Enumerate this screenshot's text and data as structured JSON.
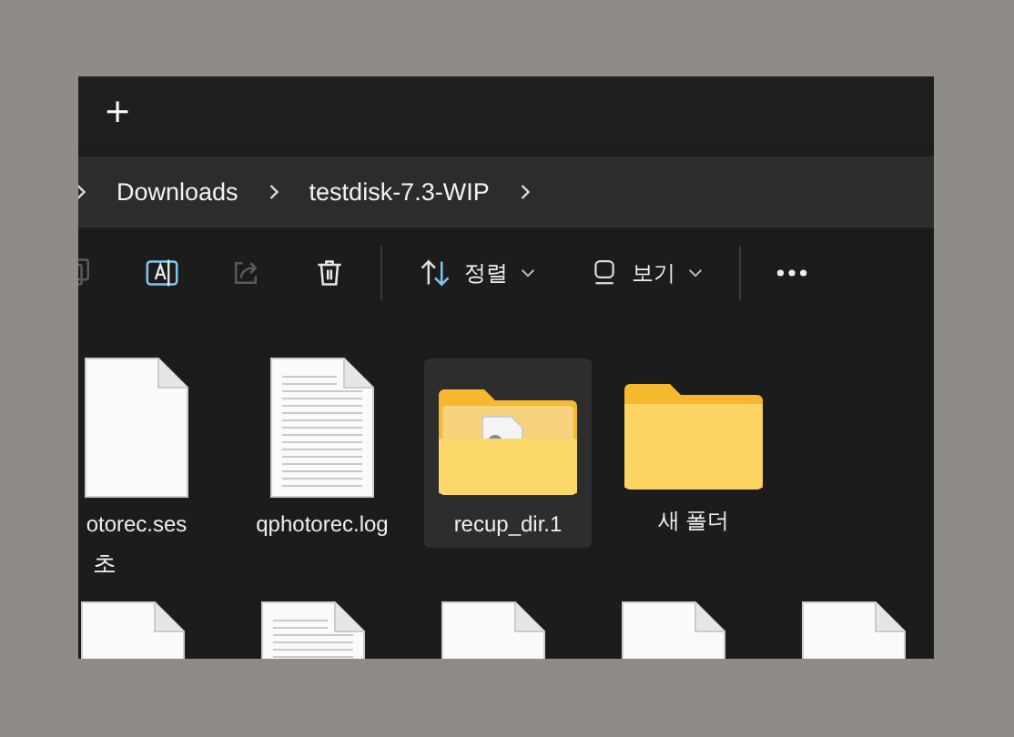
{
  "tab_bar": {
    "new_tab": "+"
  },
  "breadcrumb": {
    "items": [
      "Downloads",
      "testdisk-7.3-WIP"
    ]
  },
  "toolbar": {
    "actions": [
      {
        "kind": "copy",
        "disabled": true
      },
      {
        "kind": "rename",
        "disabled": false
      },
      {
        "kind": "share",
        "disabled": true
      },
      {
        "kind": "delete",
        "disabled": false
      }
    ],
    "sort": "정렬",
    "view": "보기"
  },
  "sections": [
    {
      "items": [
        {
          "name": "otorec.ses",
          "kind": "file",
          "selected": false
        },
        {
          "name": "qphotorec.log",
          "kind": "text",
          "selected": false
        },
        {
          "name": "recup_dir.1",
          "kind": "folder-full",
          "selected": true
        },
        {
          "name": "새 폴더",
          "kind": "folder",
          "selected": false
        }
      ]
    },
    {
      "title": "초",
      "items": [
        {
          "kind": "file",
          "selected": false
        },
        {
          "kind": "text",
          "selected": false
        },
        {
          "kind": "file",
          "selected": false
        },
        {
          "kind": "file",
          "selected": false
        },
        {
          "kind": "file",
          "selected": false
        }
      ]
    }
  ]
}
